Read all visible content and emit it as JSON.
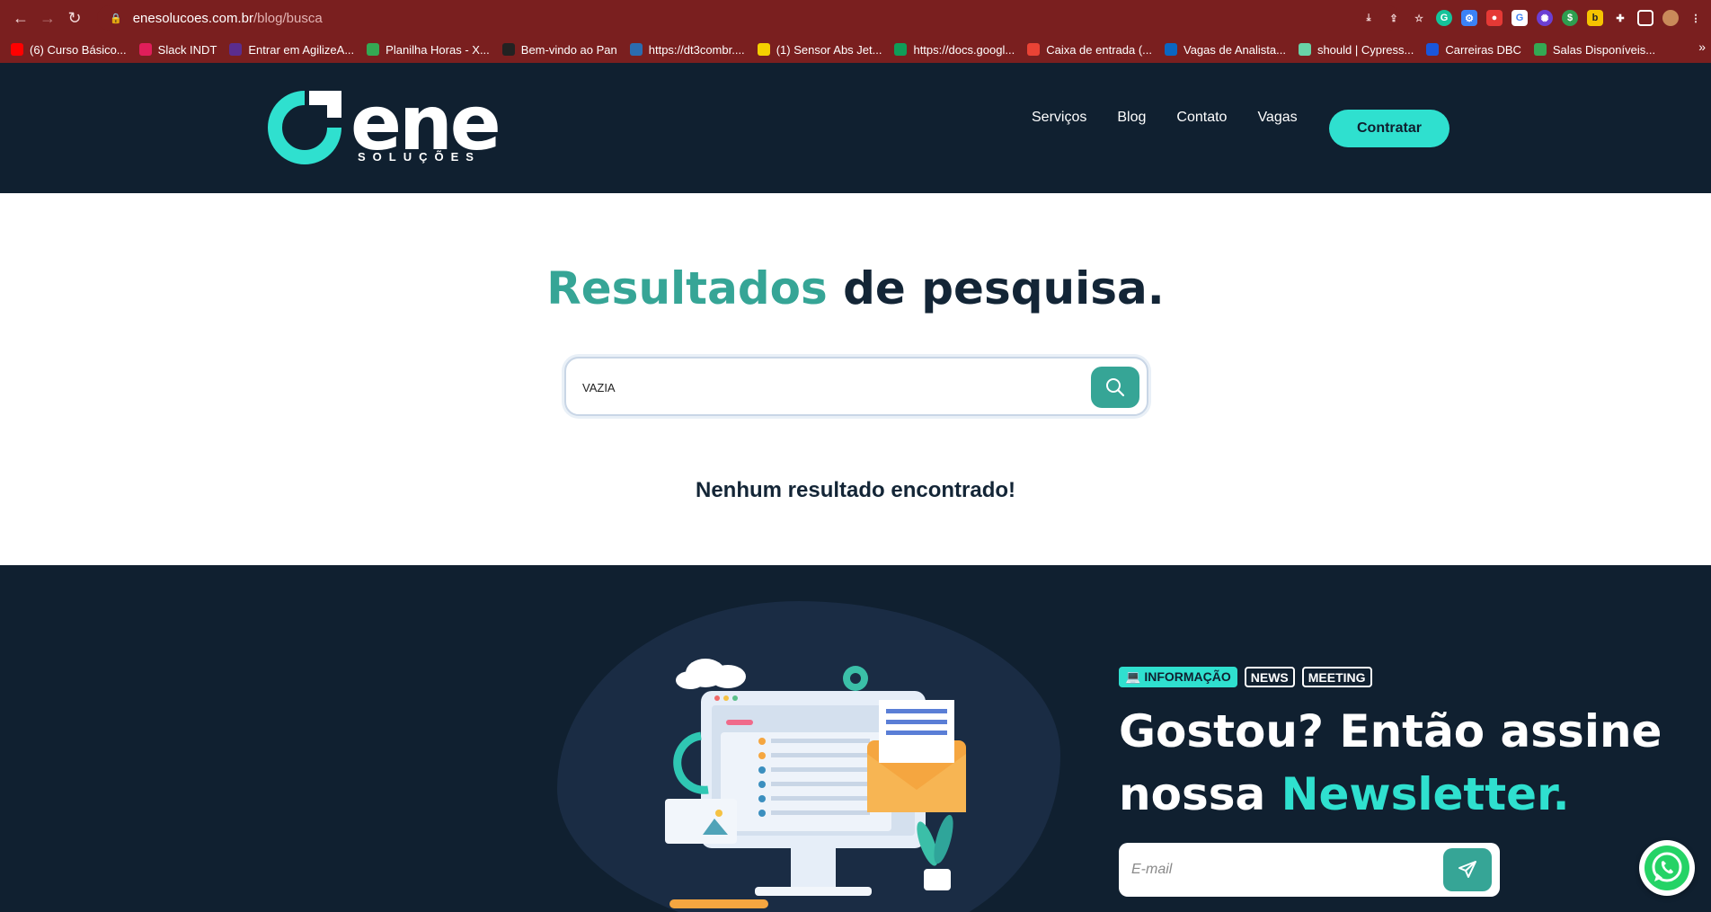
{
  "browser": {
    "url_host": "enesolucoes.com.br",
    "url_path": "/blog/busca",
    "bookmarks": [
      {
        "label": "(6) Curso Básico...",
        "color": "#ff0000"
      },
      {
        "label": "Slack INDT",
        "color": "#e01e5a"
      },
      {
        "label": "Entrar em AgilizeA...",
        "color": "#5b2d8e"
      },
      {
        "label": "Planilha Horas - X...",
        "color": "#34a853"
      },
      {
        "label": "Bem-vindo ao Pan",
        "color": "#222222"
      },
      {
        "label": "https://dt3combr....",
        "color": "#2b6cb0"
      },
      {
        "label": "(1) Sensor Abs Jet...",
        "color": "#f5d000"
      },
      {
        "label": "https://docs.googl...",
        "color": "#0f9d58"
      },
      {
        "label": "Caixa de entrada (...",
        "color": "#ea4335"
      },
      {
        "label": "Vagas de Analista...",
        "color": "#0a66c2"
      },
      {
        "label": "should | Cypress...",
        "color": "#69d3a7"
      },
      {
        "label": "Carreiras DBC",
        "color": "#1a56db"
      },
      {
        "label": "Salas Disponíveis...",
        "color": "#34a853"
      }
    ],
    "bookmarks_more": "»"
  },
  "header": {
    "logo_word": "ene",
    "logo_sub": "SOLUÇÕES",
    "nav": [
      "Serviços",
      "Blog",
      "Contato",
      "Vagas"
    ],
    "cta": "Contratar"
  },
  "search": {
    "title_highlight": "Resultados",
    "title_rest": " de pesquisa.",
    "query": "VAZIA",
    "no_results": "Nenhum resultado encontrado!"
  },
  "newsletter": {
    "tags": [
      "💻 INFORMAÇÃO",
      "NEWS",
      "MEETING"
    ],
    "title_line1": "Gostou? Então assine",
    "title_line2_plain": "nossa ",
    "title_line2_highlight": "Newsletter.",
    "email_placeholder": "E-mail"
  },
  "colors": {
    "browser_bar": "#7a1f1f",
    "header_bg": "#102030",
    "accent": "#2fe0cf",
    "teal": "#36a596"
  }
}
